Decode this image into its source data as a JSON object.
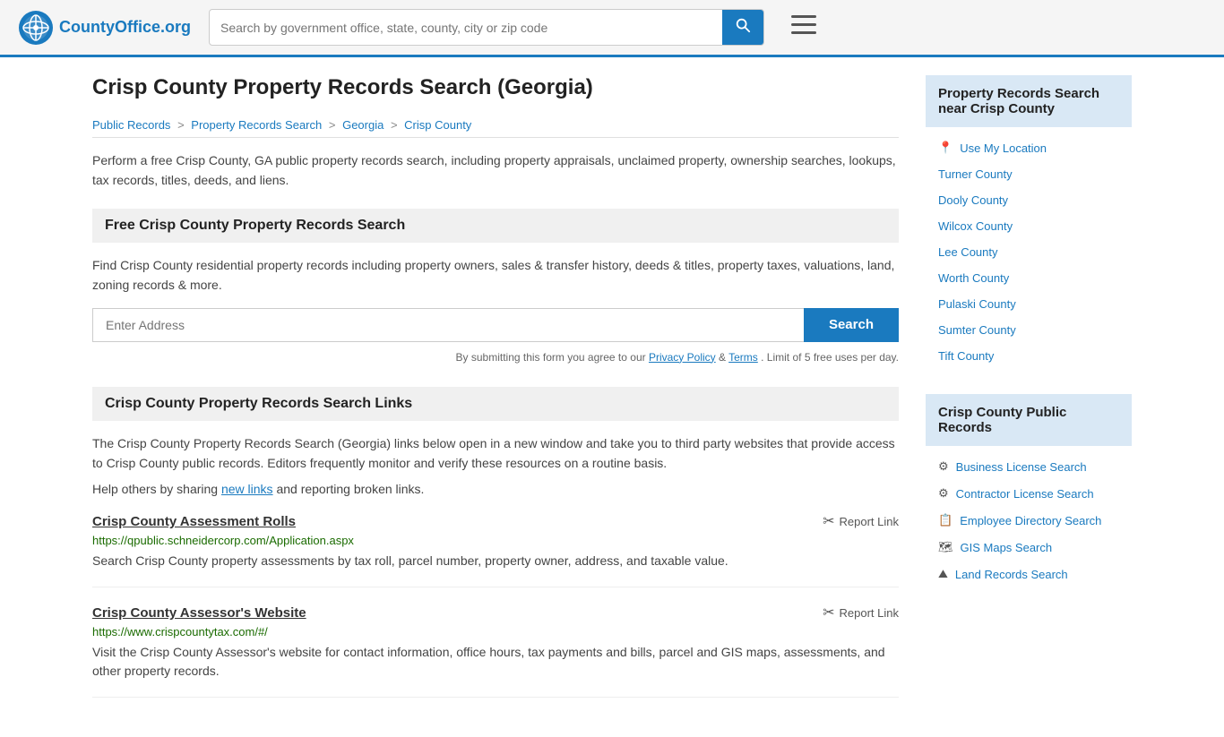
{
  "header": {
    "logo_text": "CountyOffice",
    "logo_tld": ".org",
    "search_placeholder": "Search by government office, state, county, city or zip code",
    "search_btn_label": "🔍"
  },
  "page": {
    "title": "Crisp County Property Records Search (Georgia)",
    "breadcrumb": [
      {
        "label": "Public Records",
        "href": "#"
      },
      {
        "label": "Property Records Search",
        "href": "#"
      },
      {
        "label": "Georgia",
        "href": "#"
      },
      {
        "label": "Crisp County",
        "href": "#"
      }
    ],
    "intro": "Perform a free Crisp County, GA public property records search, including property appraisals, unclaimed property, ownership searches, lookups, tax records, titles, deeds, and liens.",
    "free_search_header": "Free Crisp County Property Records Search",
    "search_desc": "Find Crisp County residential property records including property owners, sales & transfer history, deeds & titles, property taxes, valuations, land, zoning records & more.",
    "address_placeholder": "Enter Address",
    "search_button_label": "Search",
    "form_disclaimer": "By submitting this form you agree to our",
    "privacy_policy_label": "Privacy Policy",
    "terms_label": "Terms",
    "form_disclaimer_end": ". Limit of 5 free uses per day.",
    "links_header": "Crisp County Property Records Search Links",
    "links_desc": "The Crisp County Property Records Search (Georgia) links below open in a new window and take you to third party websites that provide access to Crisp County public records. Editors frequently monitor and verify these resources on a routine basis.",
    "new_links_text": "Help others by sharing",
    "new_links_anchor": "new links",
    "new_links_end": "and reporting broken links.",
    "links": [
      {
        "title": "Crisp County Assessment Rolls",
        "url": "https://qpublic.schneidercorp.com/Application.aspx",
        "desc": "Search Crisp County property assessments by tax roll, parcel number, property owner, address, and taxable value.",
        "report_label": "Report Link"
      },
      {
        "title": "Crisp County Assessor's Website",
        "url": "https://www.crispcountytax.com/#/",
        "desc": "Visit the Crisp County Assessor's website for contact information, office hours, tax payments and bills, parcel and GIS maps, assessments, and other property records.",
        "report_label": "Report Link"
      }
    ]
  },
  "sidebar": {
    "nearby_header": "Property Records Search near Crisp County",
    "use_location_label": "Use My Location",
    "nearby_counties": [
      {
        "label": "Turner County"
      },
      {
        "label": "Dooly County"
      },
      {
        "label": "Wilcox County"
      },
      {
        "label": "Lee County"
      },
      {
        "label": "Worth County"
      },
      {
        "label": "Pulaski County"
      },
      {
        "label": "Sumter County"
      },
      {
        "label": "Tift County"
      }
    ],
    "public_records_header": "Crisp County Public Records",
    "public_records_links": [
      {
        "icon": "gear",
        "label": "Business License Search"
      },
      {
        "icon": "gear",
        "label": "Contractor License Search"
      },
      {
        "icon": "book",
        "label": "Employee Directory Search"
      },
      {
        "icon": "map",
        "label": "GIS Maps Search"
      },
      {
        "icon": "land",
        "label": "Land Records Search"
      }
    ]
  }
}
